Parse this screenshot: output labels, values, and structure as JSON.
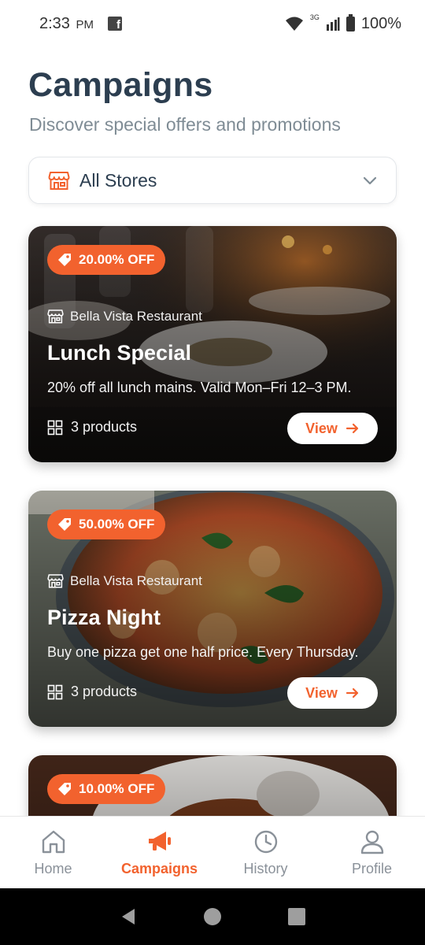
{
  "status_bar": {
    "time": "2:33",
    "ampm": "PM",
    "network": "3G",
    "battery": "100%"
  },
  "header": {
    "title": "Campaigns",
    "subtitle": "Discover special offers and promotions"
  },
  "store_filter": {
    "selected": "All Stores",
    "icon": "store-icon"
  },
  "campaigns": [
    {
      "discount": "20.00% OFF",
      "store": "Bella Vista Restaurant",
      "title": "Lunch Special",
      "description": "20% off all lunch mains. Valid Mon–Fri 12–3 PM.",
      "products": "3 products",
      "button": "View"
    },
    {
      "discount": "50.00% OFF",
      "store": "Bella Vista Restaurant",
      "title": "Pizza Night",
      "description": "Buy one pizza get one half price. Every Thursday.",
      "products": "3 products",
      "button": "View"
    },
    {
      "discount": "10.00% OFF"
    }
  ],
  "bottom_nav": {
    "items": [
      {
        "label": "Home",
        "icon": "home-icon"
      },
      {
        "label": "Campaigns",
        "icon": "megaphone-icon",
        "active": true
      },
      {
        "label": "History",
        "icon": "clock-icon"
      },
      {
        "label": "Profile",
        "icon": "user-icon"
      }
    ]
  },
  "colors": {
    "accent": "#f2622e",
    "title": "#2c3e50",
    "muted": "#8a9199"
  }
}
